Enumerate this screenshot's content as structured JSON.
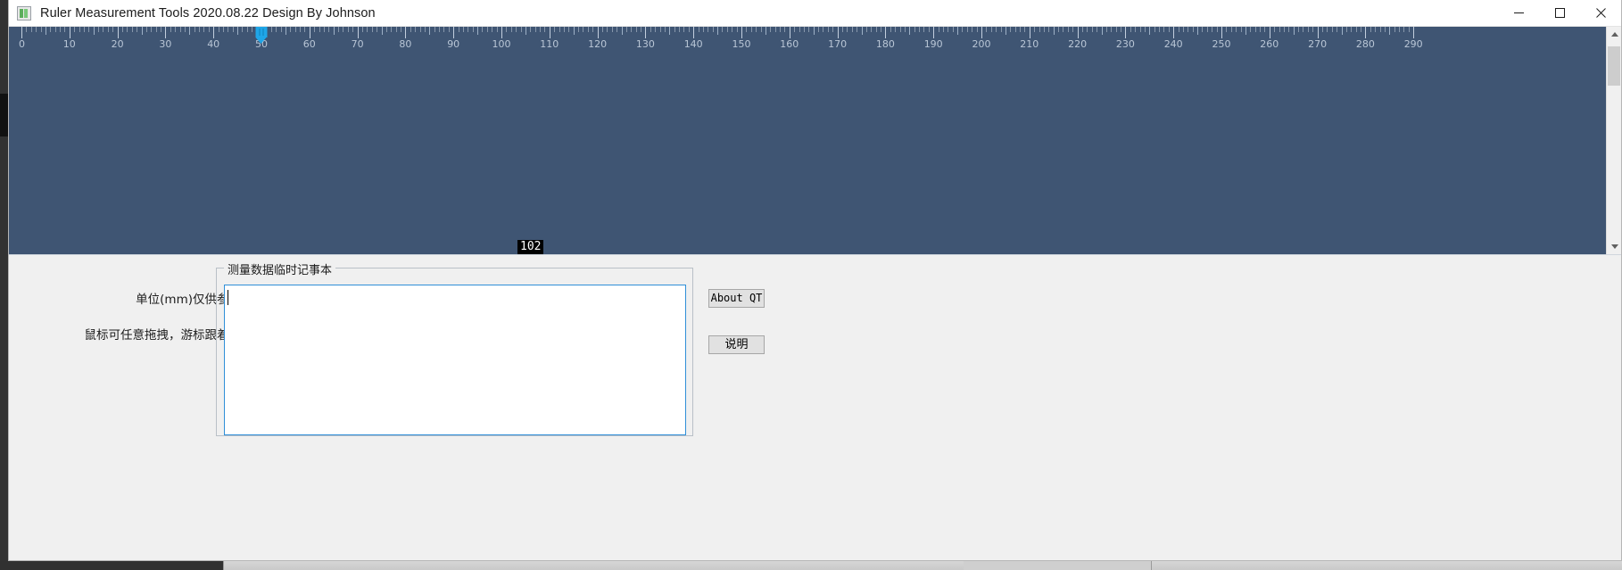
{
  "window": {
    "title": "Ruler Measurement Tools 2020.08.22 Design By Johnson",
    "app_icon": "ruler-app-icon",
    "controls": {
      "minimize": "minimize-icon",
      "maximize": "maximize-icon",
      "close": "close-icon"
    }
  },
  "ruler": {
    "background_color": "#3f5573",
    "tick_color": "#9fb0c4",
    "label_color": "#b9c6d6",
    "unit": "mm",
    "min": 0,
    "max": 290,
    "label_step": 10,
    "minor_step": 1,
    "pixels_per_unit": 5.38,
    "labels": [
      "0",
      "10",
      "20",
      "30",
      "40",
      "50",
      "60",
      "70",
      "80",
      "90",
      "100",
      "110",
      "120",
      "130",
      "140",
      "150",
      "160",
      "170",
      "180",
      "190",
      "200",
      "210",
      "220",
      "230",
      "240",
      "250",
      "260",
      "270",
      "280"
    ],
    "cursor": {
      "name": "ruler-cursor-marker",
      "position_value": 50,
      "color": "#1fa6e8"
    },
    "readout": {
      "value": "102",
      "text_color": "#ffffff",
      "background_color": "#000000"
    },
    "scrollbar": {
      "orientation": "vertical",
      "up_arrow": "scroll-up-arrow-icon",
      "down_arrow": "scroll-down-arrow-icon"
    }
  },
  "panel": {
    "hints": {
      "line1": "单位(mm)仅供参考",
      "line2": "鼠标可任意拖拽，游标跟着跑"
    },
    "groupbox": {
      "title": "测量数据临时记事本",
      "notepad": {
        "value": "",
        "placeholder": "",
        "border_color": "#2f8fd8",
        "has_caret": true
      }
    },
    "buttons": [
      {
        "name": "about-qt-button",
        "label": "About QT"
      },
      {
        "name": "help-button",
        "label": "说明"
      }
    ]
  }
}
